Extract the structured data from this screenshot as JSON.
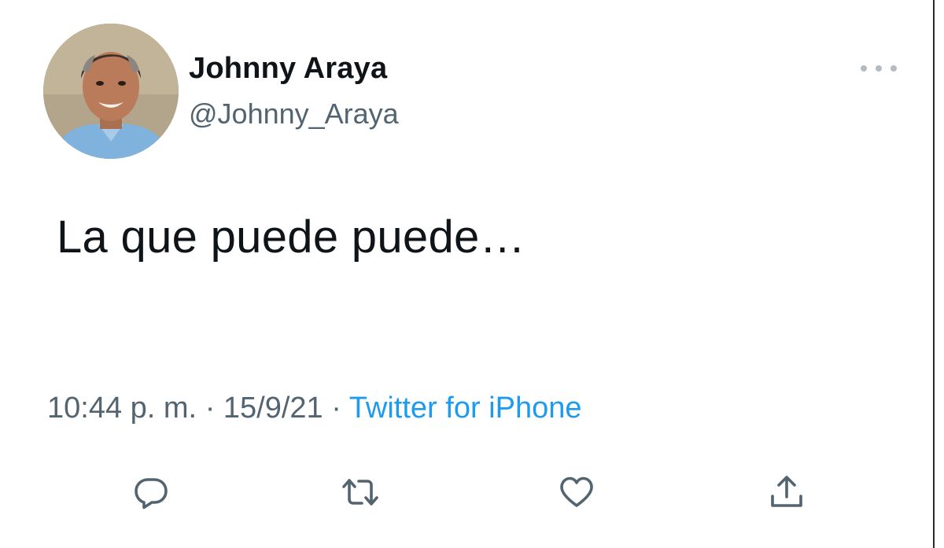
{
  "tweet": {
    "display_name": "Johnny Araya",
    "username": "@Johnny_Araya",
    "text": "La que puede puede…",
    "time": "10:44 p. m.",
    "separator": "·",
    "date": "15/9/21",
    "source": "Twitter for iPhone"
  },
  "actions": [
    {
      "icon": "reply-icon"
    },
    {
      "icon": "retweet-icon"
    },
    {
      "icon": "like-icon"
    },
    {
      "icon": "share-icon"
    }
  ],
  "colors": {
    "text": "#0f1419",
    "secondary": "#536471",
    "link": "#1d9bf0",
    "icon": "#536471"
  }
}
